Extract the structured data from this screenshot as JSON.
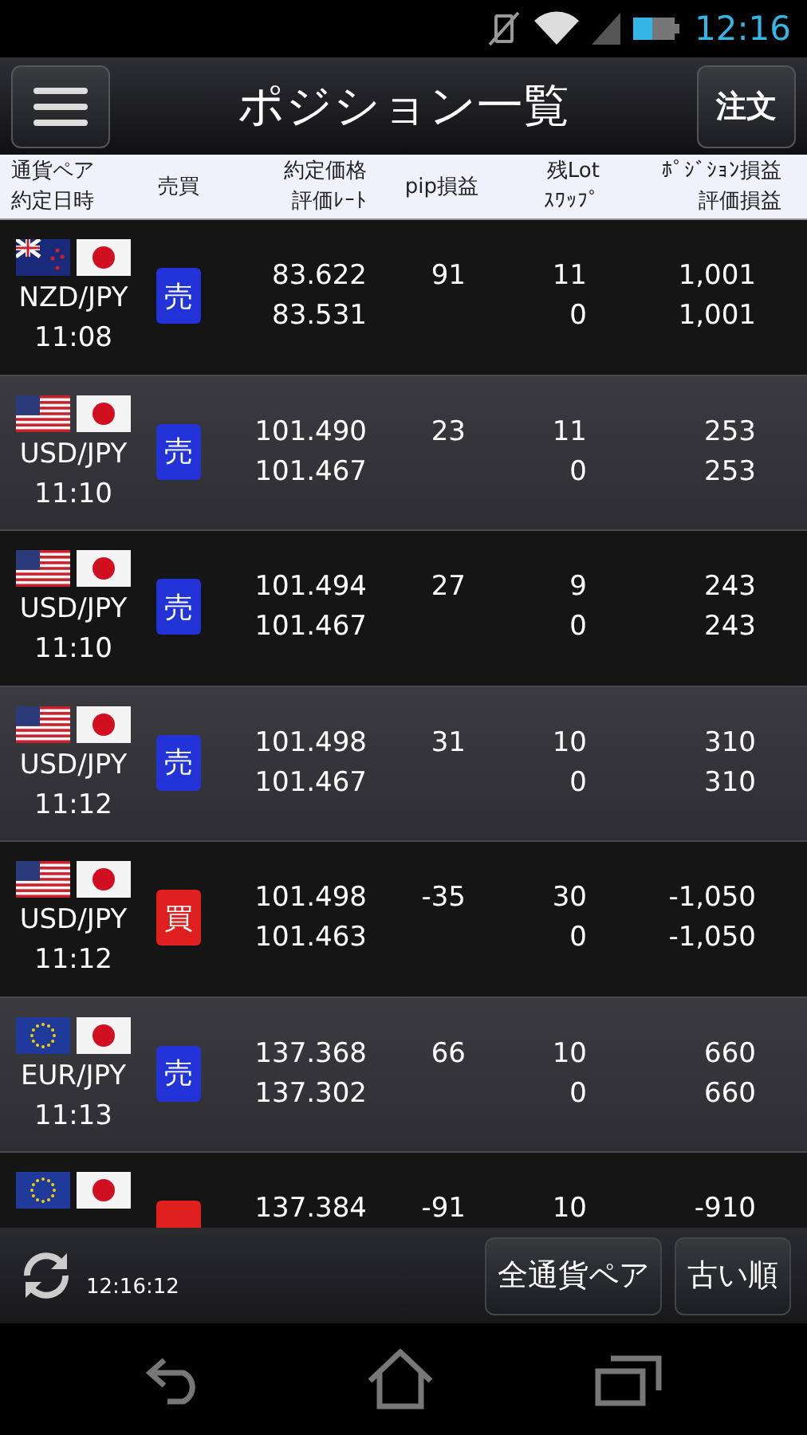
{
  "status_bar": {
    "time": "12:16"
  },
  "header": {
    "title": "ポジション一覧",
    "order_button": "注文"
  },
  "columns": [
    {
      "top": "通貨ペア",
      "bottom": "約定日時"
    },
    {
      "top": "売買"
    },
    {
      "top": "約定価格",
      "bottom": "評価ﾚｰﾄ"
    },
    {
      "top": "pip損益"
    },
    {
      "top": "残Lot",
      "bottom": "ｽﾜｯﾌﾟ"
    },
    {
      "top": "ﾎﾟｼﾞｼｮﾝ損益",
      "bottom": "評価損益"
    }
  ],
  "rows": [
    {
      "flags": [
        {
          "kind": "nz"
        },
        {
          "kind": "jp"
        }
      ],
      "pair": "NZD/JPY",
      "time": "11:08",
      "kind": "sell",
      "side_label": "売",
      "price": "83.622",
      "rate": "83.531",
      "pips": "91",
      "lot": "11",
      "swap": "0",
      "pos_pnl": "1,001",
      "eval_pnl": "1,001"
    },
    {
      "flags": [
        {
          "kind": "us"
        },
        {
          "kind": "jp"
        }
      ],
      "pair": "USD/JPY",
      "time": "11:10",
      "kind": "sell",
      "side_label": "売",
      "price": "101.490",
      "rate": "101.467",
      "pips": "23",
      "lot": "11",
      "swap": "0",
      "pos_pnl": "253",
      "eval_pnl": "253"
    },
    {
      "flags": [
        {
          "kind": "us"
        },
        {
          "kind": "jp"
        }
      ],
      "pair": "USD/JPY",
      "time": "11:10",
      "kind": "sell",
      "side_label": "売",
      "price": "101.494",
      "rate": "101.467",
      "pips": "27",
      "lot": "9",
      "swap": "0",
      "pos_pnl": "243",
      "eval_pnl": "243"
    },
    {
      "flags": [
        {
          "kind": "us"
        },
        {
          "kind": "jp"
        }
      ],
      "pair": "USD/JPY",
      "time": "11:12",
      "kind": "sell",
      "side_label": "売",
      "price": "101.498",
      "rate": "101.467",
      "pips": "31",
      "lot": "10",
      "swap": "0",
      "pos_pnl": "310",
      "eval_pnl": "310"
    },
    {
      "flags": [
        {
          "kind": "us"
        },
        {
          "kind": "jp"
        }
      ],
      "pair": "USD/JPY",
      "time": "11:12",
      "kind": "buy",
      "side_label": "買",
      "price": "101.498",
      "rate": "101.463",
      "pips": "-35",
      "lot": "30",
      "swap": "0",
      "pos_pnl": "-1,050",
      "eval_pnl": "-1,050"
    },
    {
      "flags": [
        {
          "kind": "eu"
        },
        {
          "kind": "jp"
        }
      ],
      "pair": "EUR/JPY",
      "time": "11:13",
      "kind": "sell",
      "side_label": "売",
      "price": "137.368",
      "rate": "137.302",
      "pips": "66",
      "lot": "10",
      "swap": "0",
      "pos_pnl": "660",
      "eval_pnl": "660"
    },
    {
      "flags": [
        {
          "kind": "eu"
        },
        {
          "kind": "jp"
        }
      ],
      "kind": "buy",
      "price": "137.384",
      "pips": "-91",
      "lot": "10",
      "pos_pnl": "-910"
    }
  ],
  "footer": {
    "updated": "12:16:12",
    "buttons": [
      "全通貨ペア",
      "古い順"
    ]
  }
}
